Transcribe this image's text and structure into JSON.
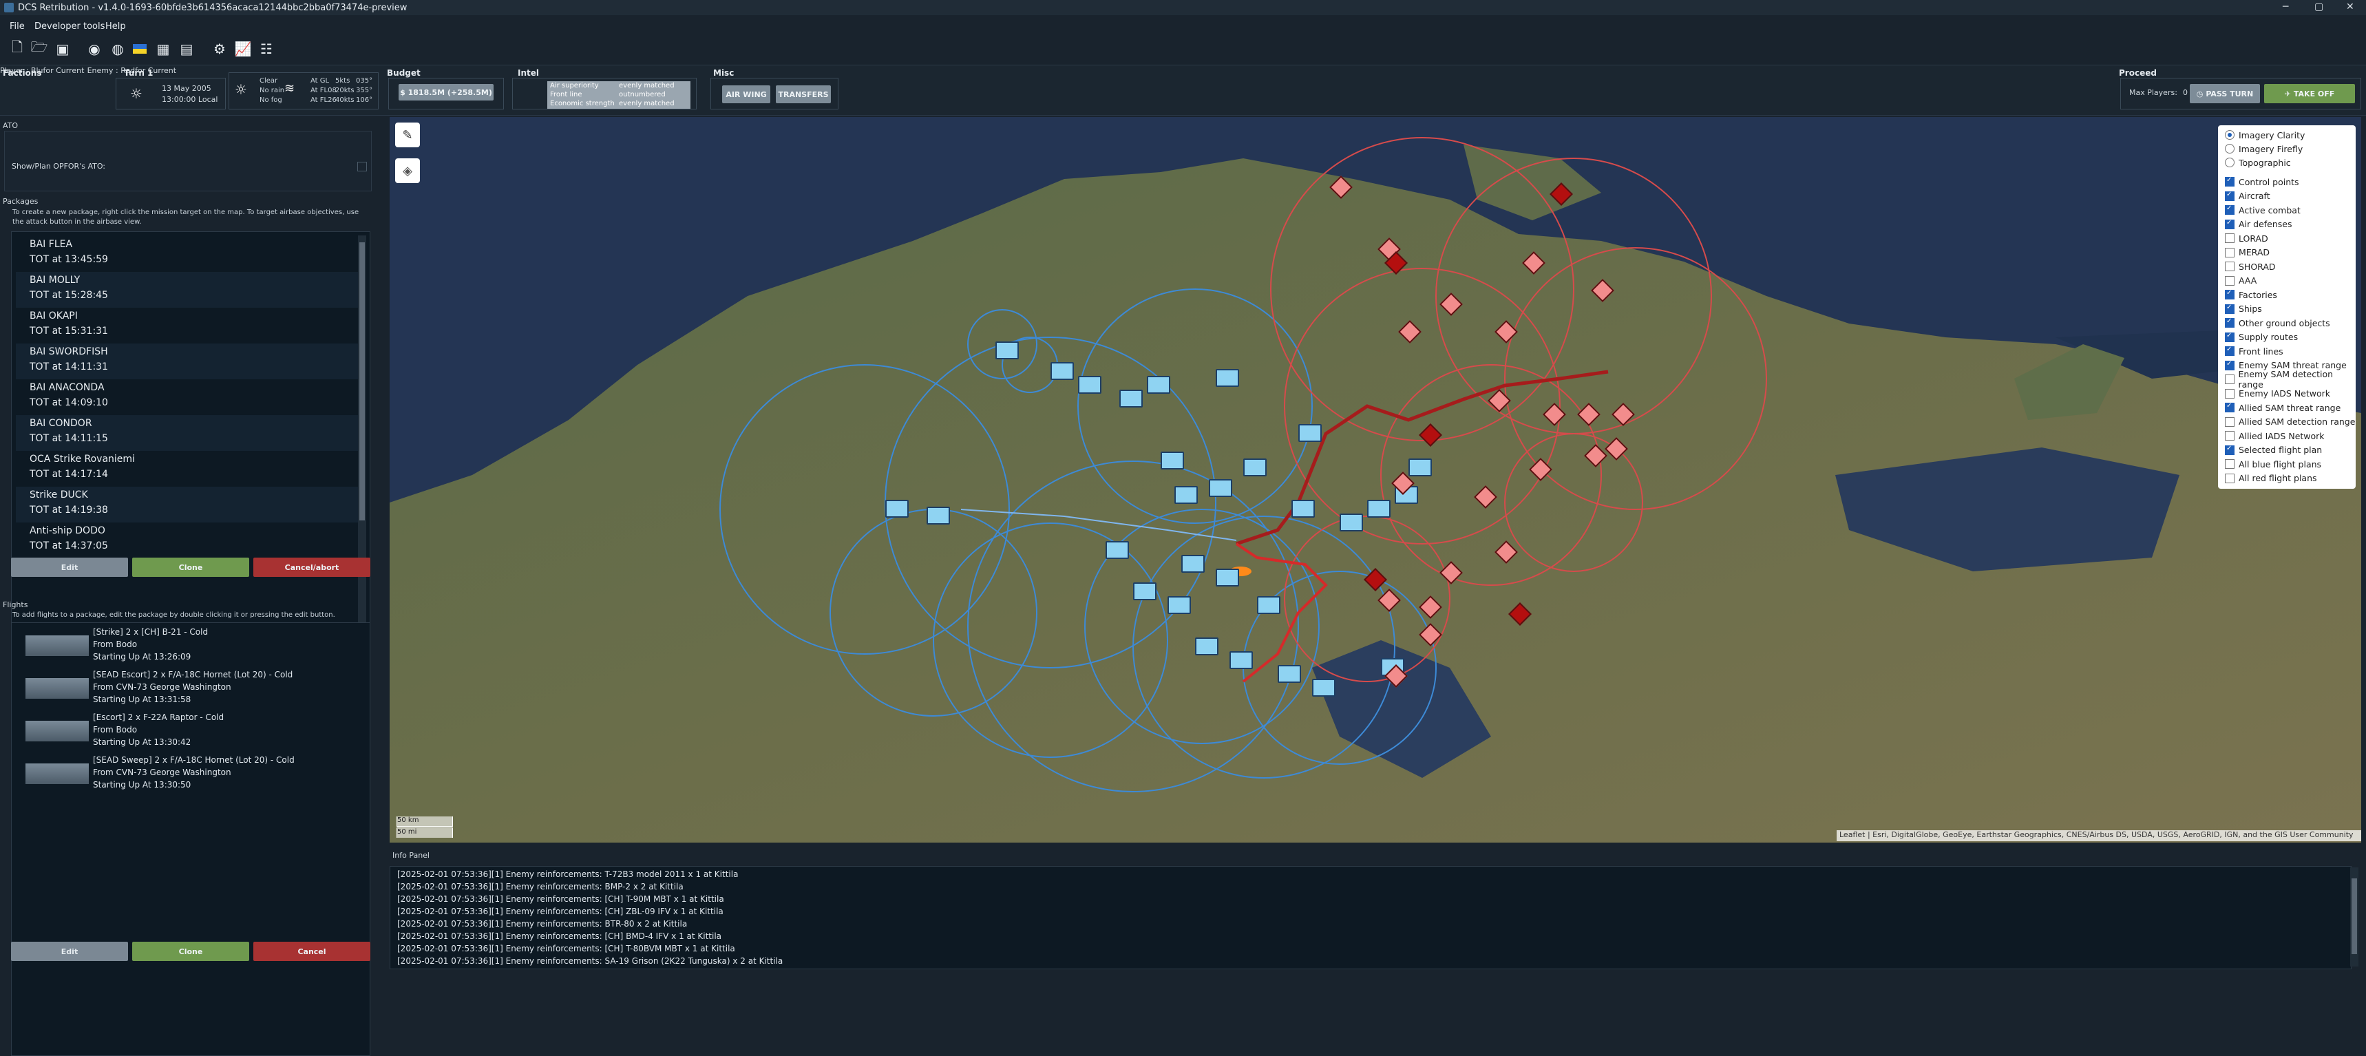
{
  "window": {
    "title": "DCS Retribution - v1.4.0-1693-60bfde3b614356acaca12144bbc2bba0f73474e-preview"
  },
  "menu": [
    "File",
    "Developer tools",
    "Help"
  ],
  "factions": {
    "label": "Factions",
    "player": "Player : Blufor Current",
    "enemy": "Enemy : Redfor Current"
  },
  "turn": {
    "label": "Turn 1",
    "date": "13 May 2005",
    "time": "13:00:00 Local"
  },
  "weather": {
    "conditions": [
      "Clear",
      "No rain",
      "No fog"
    ],
    "winds": [
      {
        "alt": "At GL",
        "speed": "5kts",
        "dir": "035°"
      },
      {
        "alt": "At FL08",
        "speed": "20kts",
        "dir": "355°"
      },
      {
        "alt": "At FL26",
        "speed": "40kts",
        "dir": "106°"
      }
    ]
  },
  "budget": {
    "label": "Budget",
    "value": "$ 1818.5M (+258.5M)"
  },
  "intel": {
    "label": "Intel",
    "rows": [
      {
        "k": "Air superiority",
        "v": "evenly matched"
      },
      {
        "k": "Front line",
        "v": "outnumbered"
      },
      {
        "k": "Economic strength",
        "v": "evenly matched"
      }
    ]
  },
  "misc": {
    "label": "Misc",
    "air_wing": "AIR WING",
    "transfers": "TRANSFERS"
  },
  "proceed": {
    "label": "Proceed",
    "max_players": "Max Players:",
    "max_players_value": "0",
    "pass_turn": "PASS TURN",
    "take_off": "TAKE OFF"
  },
  "ato": {
    "label": "ATO",
    "show_opfor": "Show/Plan OPFOR's ATO:"
  },
  "packages": {
    "label": "Packages",
    "hint": "To create a new package, right click the mission target on the map. To target airbase objectives, use the attack button in the airbase view.",
    "items": [
      {
        "name": "BAI FLEA",
        "tot": "TOT at 13:45:59"
      },
      {
        "name": "BAI MOLLY",
        "tot": "TOT at 15:28:45"
      },
      {
        "name": "BAI OKAPI",
        "tot": "TOT at 15:31:31"
      },
      {
        "name": "BAI SWORDFISH",
        "tot": "TOT at 14:11:31"
      },
      {
        "name": "BAI ANACONDA",
        "tot": "TOT at 14:09:10"
      },
      {
        "name": "BAI CONDOR",
        "tot": "TOT at 14:11:15"
      },
      {
        "name": "OCA Strike Rovaniemi",
        "tot": "TOT at 14:17:14"
      },
      {
        "name": "Strike DUCK",
        "tot": "TOT at 14:19:38"
      },
      {
        "name": "Anti-ship DODO",
        "tot": "TOT at 14:37:05"
      }
    ],
    "edit": "Edit",
    "clone": "Clone",
    "cancel": "Cancel/abort"
  },
  "flights": {
    "label": "Flights",
    "hint": "To add flights to a package, edit the package by double clicking it or pressing the edit button.",
    "items": [
      {
        "l1": "[Strike] 2 x [CH] B-21 - Cold",
        "l2": "From Bodo",
        "l3": "Starting Up At 13:26:09"
      },
      {
        "l1": "[SEAD Escort] 2 x F/A-18C Hornet (Lot 20) - Cold",
        "l2": "From CVN-73 George Washington",
        "l3": "Starting Up At 13:31:58"
      },
      {
        "l1": "[Escort] 2 x F-22A Raptor - Cold",
        "l2": "From Bodo",
        "l3": "Starting Up At 13:30:42"
      },
      {
        "l1": "[SEAD Sweep] 2 x F/A-18C Hornet (Lot 20) - Cold",
        "l2": "From CVN-73 George Washington",
        "l3": "Starting Up At 13:30:50"
      }
    ],
    "edit": "Edit",
    "clone": "Clone",
    "cancel": "Cancel"
  },
  "map": {
    "scale_km": "50 km",
    "scale_mi": "50 mi",
    "attribution": "Leaflet | Esri, DigitalGlobe, GeoEye, Earthstar Geographics, CNES/Airbus DS, USDA, USGS, AeroGRID, IGN, and the GIS User Community",
    "basemaps": [
      {
        "label": "Imagery Clarity",
        "on": true
      },
      {
        "label": "Imagery Firefly",
        "on": false
      },
      {
        "label": "Topographic",
        "on": false
      }
    ],
    "layers": [
      {
        "label": "Control points",
        "on": true
      },
      {
        "label": "Aircraft",
        "on": true
      },
      {
        "label": "Active combat",
        "on": true
      },
      {
        "label": "Air defenses",
        "on": true
      },
      {
        "label": "LORAD",
        "on": false
      },
      {
        "label": "MERAD",
        "on": false
      },
      {
        "label": "SHORAD",
        "on": false
      },
      {
        "label": "AAA",
        "on": false
      },
      {
        "label": "Factories",
        "on": true
      },
      {
        "label": "Ships",
        "on": true
      },
      {
        "label": "Other ground objects",
        "on": true
      },
      {
        "label": "Supply routes",
        "on": true
      },
      {
        "label": "Front lines",
        "on": true
      },
      {
        "label": "Enemy SAM threat range",
        "on": true
      },
      {
        "label": "Enemy SAM detection range",
        "on": false
      },
      {
        "label": "Enemy IADS Network",
        "on": false
      },
      {
        "label": "Allied SAM threat range",
        "on": true
      },
      {
        "label": "Allied SAM detection range",
        "on": false
      },
      {
        "label": "Allied IADS Network",
        "on": false
      },
      {
        "label": "Selected flight plan",
        "on": true
      },
      {
        "label": "All blue flight plans",
        "on": false
      },
      {
        "label": "All red flight plans",
        "on": false
      }
    ]
  },
  "info_panel": {
    "label": "Info Panel",
    "lines": [
      "[2025-02-01 07:53:36][1] Enemy reinforcements: T-72B3 model 2011 x 1 at Kittila",
      "[2025-02-01 07:53:36][1] Enemy reinforcements: BMP-2 x 2 at Kittila",
      "[2025-02-01 07:53:36][1] Enemy reinforcements: [CH] T-90M MBT x 1 at Kittila",
      "[2025-02-01 07:53:36][1] Enemy reinforcements: [CH] ZBL-09 IFV x 1 at Kittila",
      "[2025-02-01 07:53:36][1] Enemy reinforcements: BTR-80 x 2 at Kittila",
      "[2025-02-01 07:53:36][1] Enemy reinforcements: [CH] BMD-4 IFV x 1 at Kittila",
      "[2025-02-01 07:53:36][1] Enemy reinforcements: [CH] T-80BVM MBT x 1 at Kittila",
      "[2025-02-01 07:53:36][1] Enemy reinforcements: SA-19 Grison (2K22 Tunguska) x 2 at Kittila"
    ]
  }
}
